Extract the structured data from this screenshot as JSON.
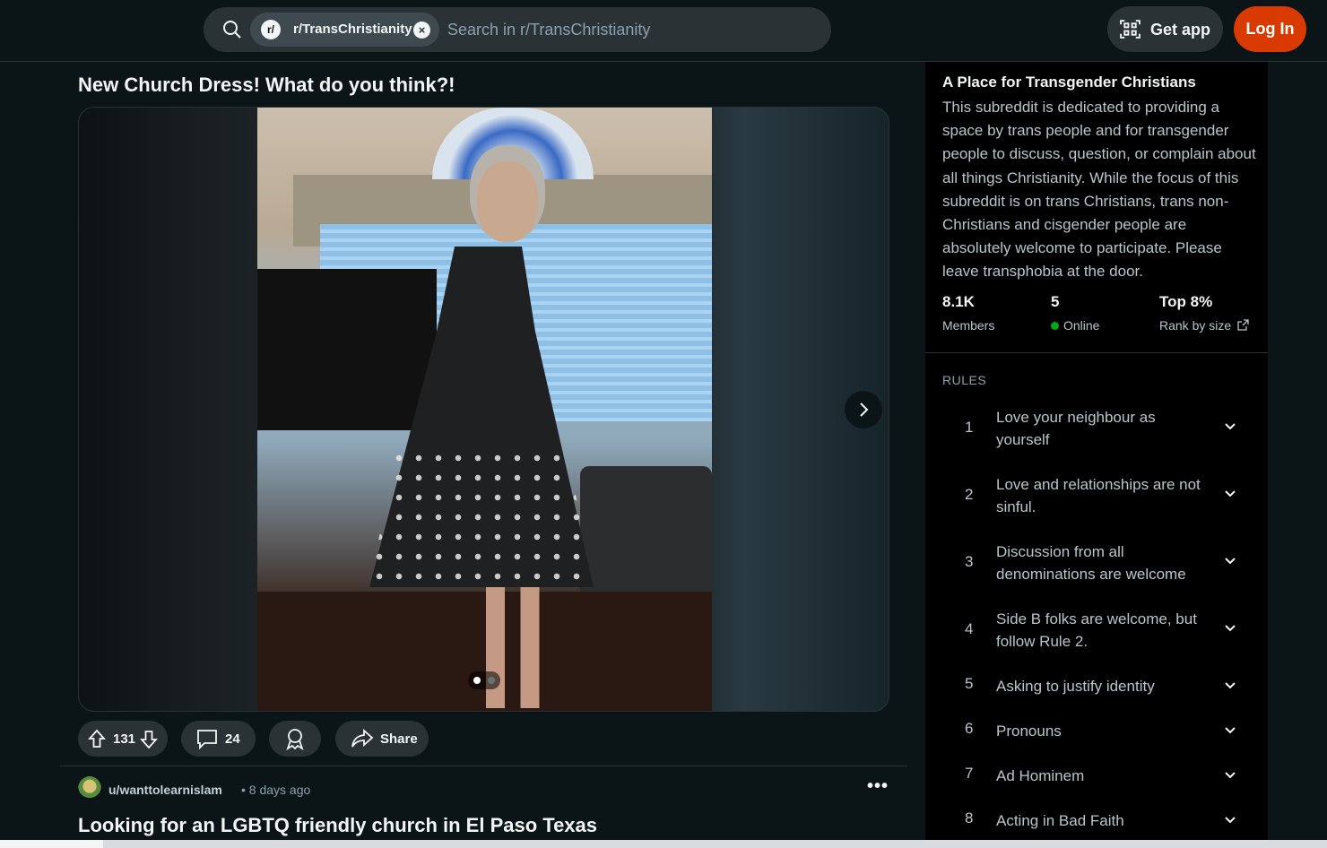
{
  "header": {
    "search_chip": "r/TransChristianity",
    "search_chip_logo": "r/",
    "search_placeholder": "Search in r/TransChristianity",
    "get_app_label": "Get app",
    "login_label": "Log In",
    "accent_color": "#d93a00"
  },
  "post": {
    "title": "New Church Dress! What do you think?!",
    "gallery_index": 1,
    "gallery_count": 2,
    "upvotes": "131",
    "comments": "24",
    "share_label": "Share"
  },
  "next_post": {
    "user": "u/wanttolearnislam",
    "time": "• 8 days ago",
    "title": "Looking for an LGBTQ friendly church in El Paso Texas",
    "more": "•••"
  },
  "sidebar": {
    "title": "A Place for Transgender Christians",
    "description": "This subreddit is dedicated to providing a space by trans people and for transgender people to discuss, question, or complain about all things Christianity. While the focus of this subreddit is on trans Christians, trans non-Christians and cisgender people are absolutely welcome to participate. Please leave transphobia at the door.",
    "stats": [
      {
        "value": "8.1K",
        "label": "Members"
      },
      {
        "value": "5",
        "label": "Online"
      },
      {
        "value": "Top 8%",
        "label": "Rank by size"
      }
    ],
    "rules_heading": "RULES",
    "rules": [
      {
        "num": "1",
        "text": "Love your neighbour as yourself"
      },
      {
        "num": "2",
        "text": "Love and relationships are not sinful."
      },
      {
        "num": "3",
        "text": "Discussion from all denominations are welcome"
      },
      {
        "num": "4",
        "text": "Side B folks are welcome, but follow Rule 2."
      },
      {
        "num": "5",
        "text": "Asking to justify identity"
      },
      {
        "num": "6",
        "text": "Pronouns"
      },
      {
        "num": "7",
        "text": "Ad Hominem"
      },
      {
        "num": "8",
        "text": "Acting in Bad Faith"
      }
    ]
  }
}
